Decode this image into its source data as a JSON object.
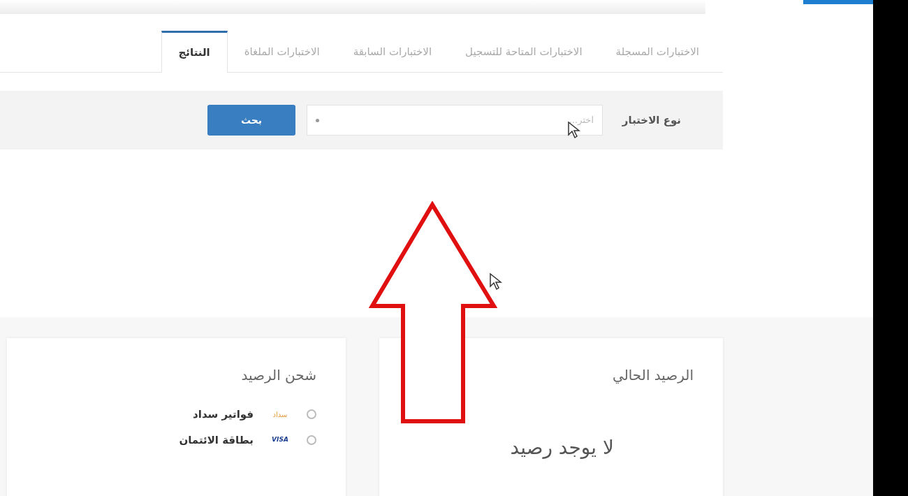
{
  "tabs": [
    {
      "label": "الاختبارات المسجلة",
      "selected": false
    },
    {
      "label": "الاختبارات المتاحة للتسجيل",
      "selected": false
    },
    {
      "label": "الاختبارات السابقة",
      "selected": false
    },
    {
      "label": "الاختبارات الملغاة",
      "selected": false
    },
    {
      "label": "النتائج",
      "selected": true
    }
  ],
  "filter": {
    "label": "نوع الاختبار",
    "select": {
      "placeholder": "اختر..."
    },
    "button": "بحث"
  },
  "balance_card": {
    "title": "الرصيد الحالي",
    "message": "لا يوجد رصيد"
  },
  "topup_card": {
    "title": "شحن الرصيد",
    "options": [
      {
        "kind": "sadad",
        "logo": "سداد",
        "label": "فواتير سداد",
        "selected": false
      },
      {
        "kind": "card",
        "logo": "VISA",
        "label": "بطاقة الائتمان",
        "selected": false
      }
    ]
  }
}
